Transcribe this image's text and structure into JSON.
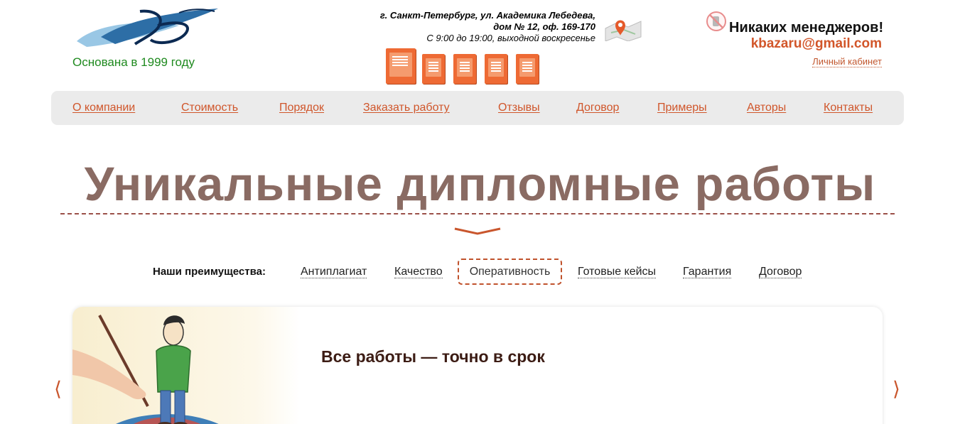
{
  "header": {
    "founded": "Основана в 1999 году",
    "address_line1": "г. Санкт-Петербург, ул. Академика Лебедева,",
    "address_line2": "дом № 12, оф. 169-170",
    "hours": "С 9:00 до 19:00, выходной воскресенье",
    "no_managers": "Никаких менеджеров!",
    "email": "kbazaru@gmail.com",
    "cabinet": "Личный кабинет"
  },
  "nav": {
    "items": [
      {
        "label": "О компании"
      },
      {
        "label": "Стоимость"
      },
      {
        "label": "Порядок"
      },
      {
        "label": "Заказать работу"
      },
      {
        "label": "Отзывы"
      },
      {
        "label": "Договор"
      },
      {
        "label": "Примеры"
      },
      {
        "label": "Авторы"
      },
      {
        "label": "Контакты"
      }
    ]
  },
  "hero": {
    "title": "Уникальные дипломные работы"
  },
  "advantages": {
    "label": "Наши преимущества:",
    "tabs": [
      {
        "label": "Антиплагиат"
      },
      {
        "label": "Качество"
      },
      {
        "label": "Оперативность"
      },
      {
        "label": "Готовые кейсы"
      },
      {
        "label": "Гарантия"
      },
      {
        "label": "Договор"
      }
    ],
    "active": "Оперативность"
  },
  "slider": {
    "heading": "Все работы — точно в срок",
    "prev": "⟨",
    "next": "⟩"
  },
  "colors": {
    "accent": "#d0562b",
    "title": "#8a6b63",
    "nav_bg": "#ebebeb",
    "founded": "#1f8a1f"
  }
}
